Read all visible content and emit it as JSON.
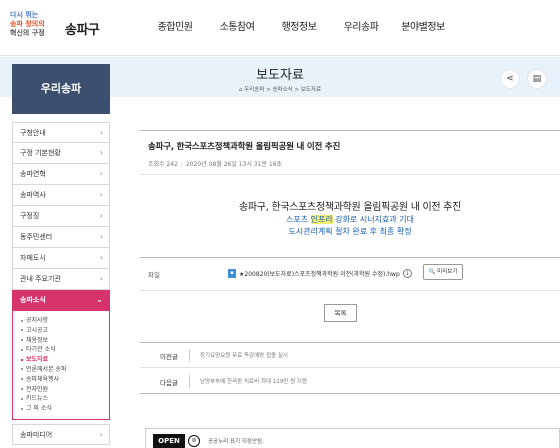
{
  "header": {
    "slogan": [
      "다시 뛰는",
      "송파 창의의",
      "혁신의 구정"
    ],
    "logo_name": "송파구",
    "gnb": [
      "종합민원",
      "소통참여",
      "행정정보",
      "우리송파",
      "분야별정보"
    ]
  },
  "sidebar": {
    "title": "우리송파",
    "items": [
      {
        "label": "구청안내",
        "icon": "chevron-right-icon"
      },
      {
        "label": "구정 기본현황",
        "icon": "chevron-right-icon"
      },
      {
        "label": "송파연혁",
        "icon": "chevron-right-icon"
      },
      {
        "label": "송파역사",
        "icon": "chevron-right-icon"
      },
      {
        "label": "구정징",
        "icon": "chevron-right-icon"
      },
      {
        "label": "동주민센터",
        "icon": "chevron-right-icon"
      },
      {
        "label": "자매도시",
        "icon": "chevron-right-icon"
      },
      {
        "label": "관내 주요기관",
        "icon": "chevron-right-icon"
      },
      {
        "label": "송파소식",
        "icon": "chevron-down-icon"
      }
    ],
    "sub_items": [
      "공지사항",
      "고시공고",
      "채용정보",
      "타기관 소식",
      "보도자료",
      "언론에서본 송파",
      "송파체육행사",
      "전자민원",
      "카드뉴스",
      "그 외 소식"
    ],
    "current_sub": "보도자료",
    "after": [
      {
        "label": "송파미디어",
        "icon": "chevron-right-icon"
      }
    ]
  },
  "page": {
    "title": "보도자료",
    "breadcrumb": "⌂ 우리송파 > 송파소식 > 보도자료"
  },
  "article": {
    "title": "송파구, 한국스포츠정책과학원 올림픽공원 내 이전 추진",
    "views_label": "조회수 242",
    "date": "2020년 08월 26일 13시 31분 16초",
    "headline": "송파구, 한국스포츠정책과학원 올림픽공원 내 이전 추진",
    "sub1_pre": "스포츠 ",
    "sub1_hl": "인프라",
    "sub1_post": " 강화로 시너지효과 기대",
    "sub2": "도시관리계획 절차 완료 후 최종 확정",
    "file_label": "파일",
    "file_name": "★200820(보도자료)스포츠정책과학원 이전(과학원 수정).hwp",
    "preview_label": "미리보기",
    "list_label": "목록",
    "prev_label": "이전글",
    "prev_text": "장기요양요원 무료 독감예방 접종 실시",
    "next_label": "다음글",
    "next_text": "남양부부에 한국판 치료비 최대 119만 원 지원",
    "license_badge": "OPEN",
    "license_text": "공공누리 표기 지정안됨."
  }
}
